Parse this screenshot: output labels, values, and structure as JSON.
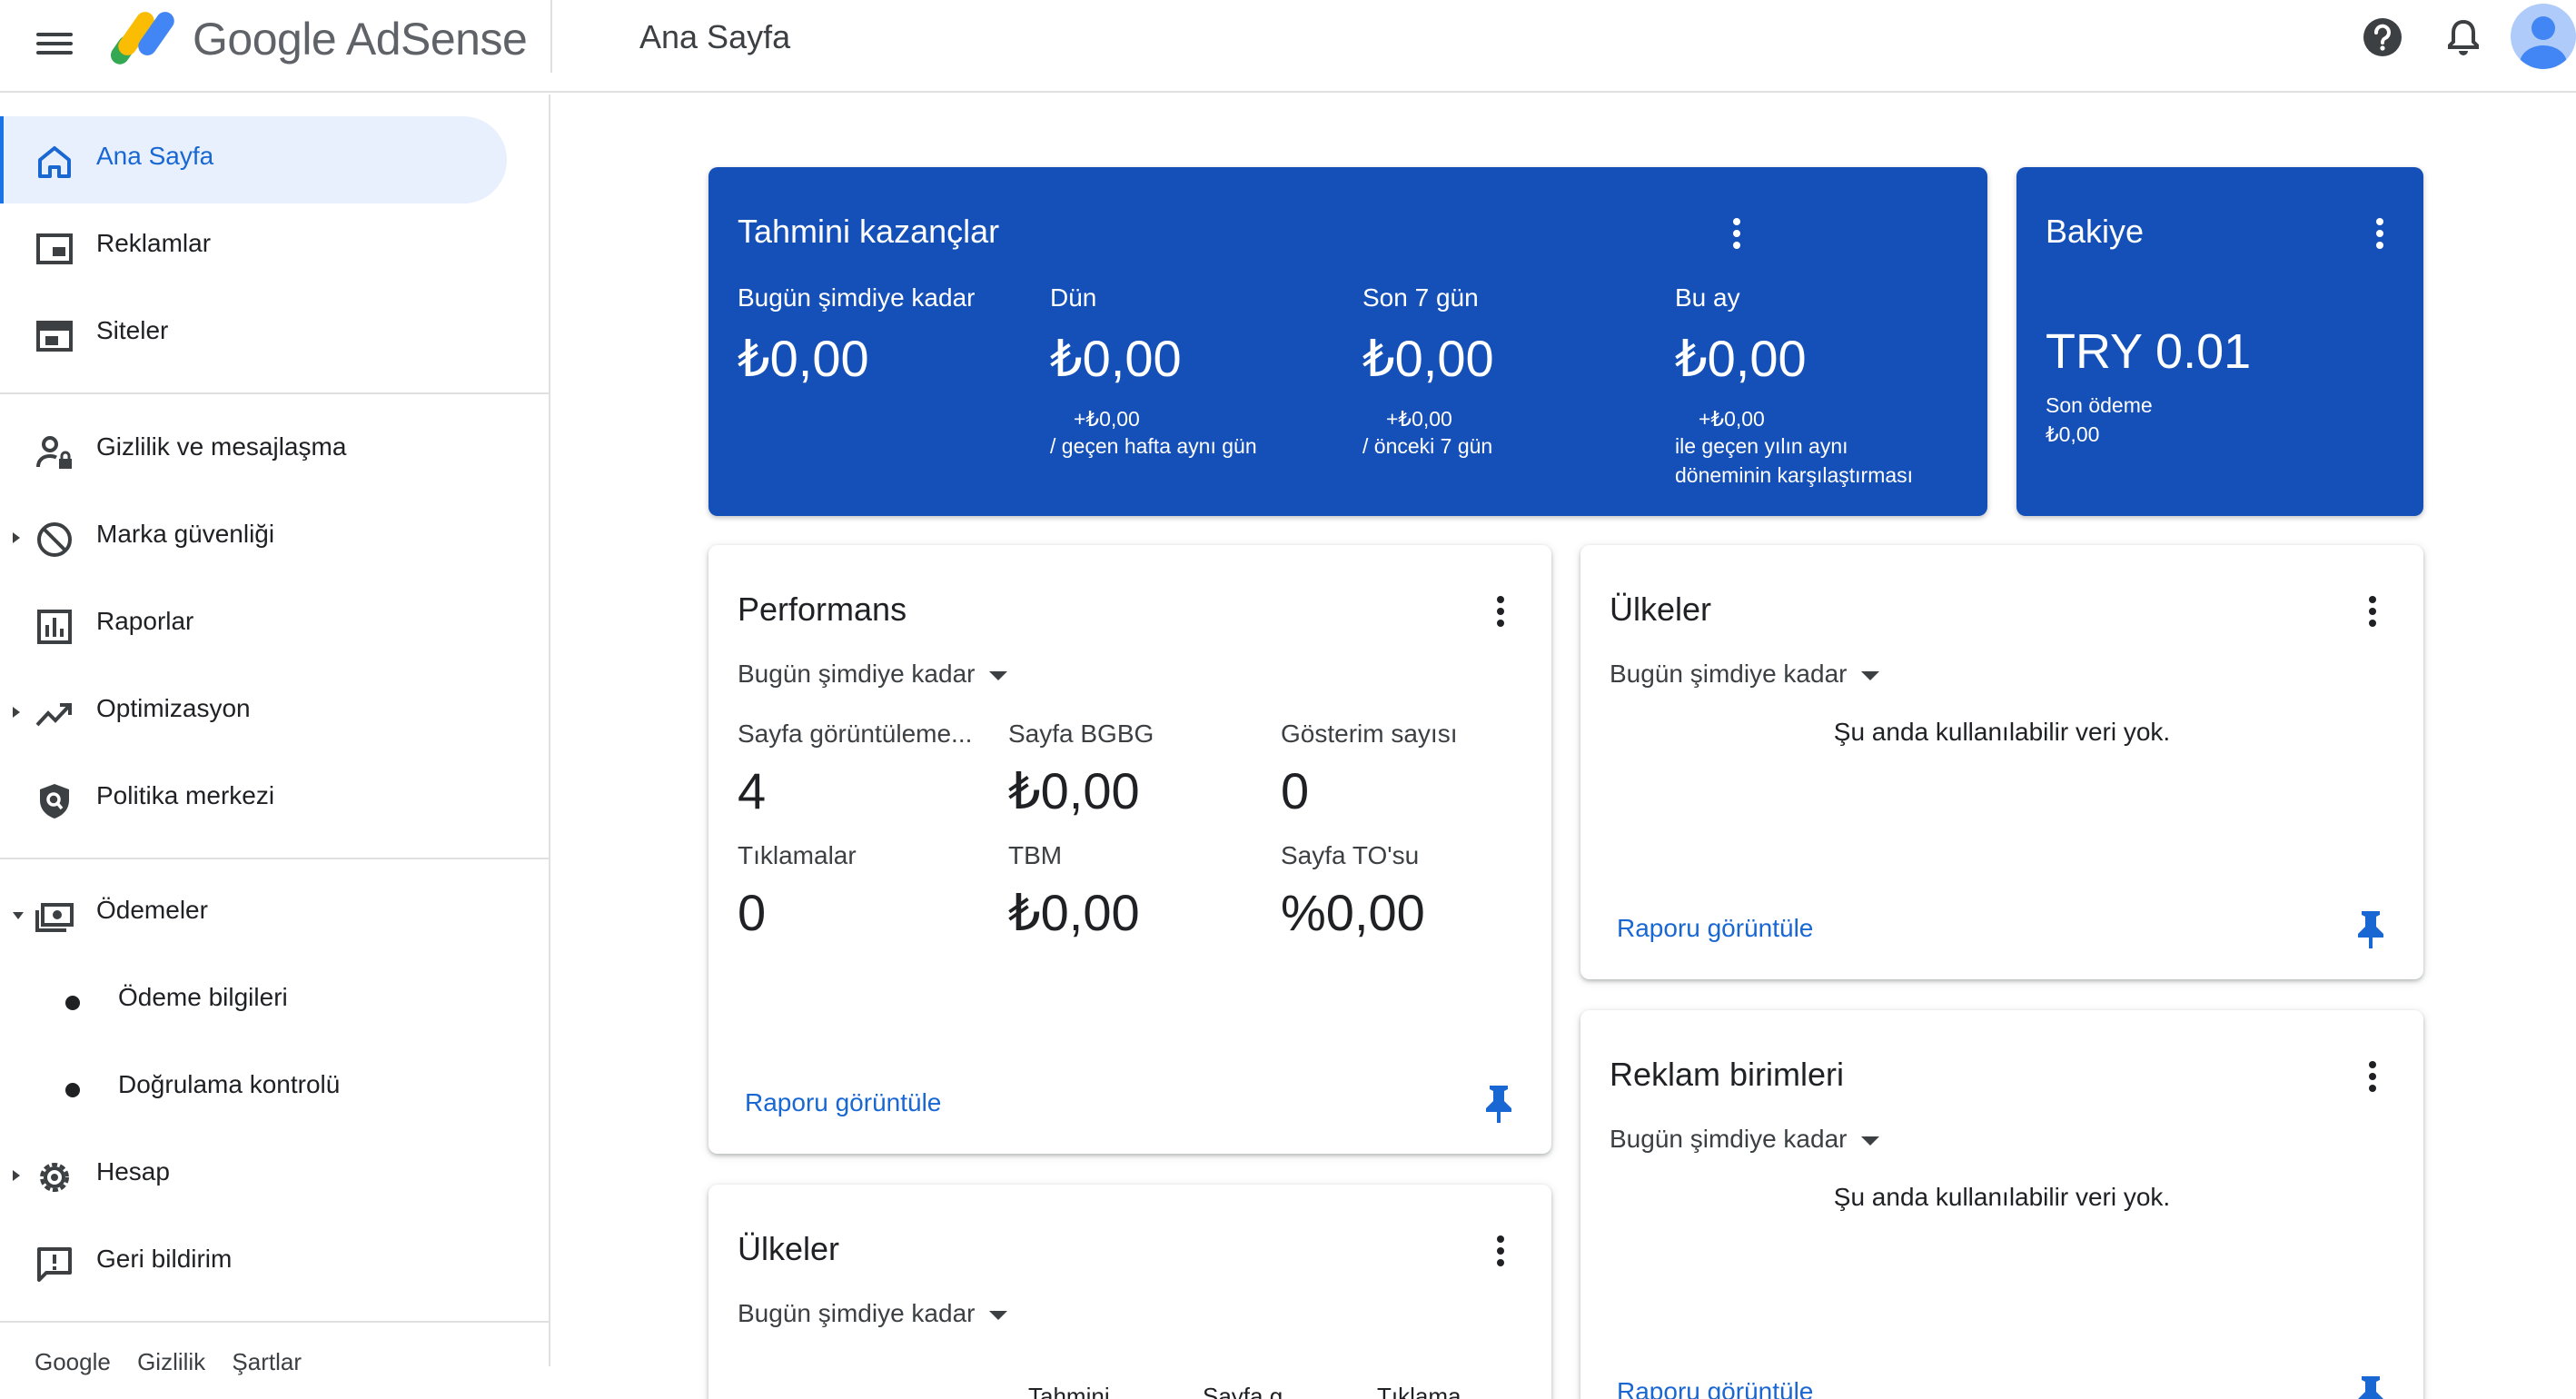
{
  "header": {
    "brand": "Google AdSense",
    "page_title": "Ana Sayfa"
  },
  "icons": {
    "menu": "menu-icon",
    "help": "help-icon",
    "notifications": "bell-icon",
    "account": "avatar"
  },
  "colors": {
    "primary_blue": "#1550b8",
    "accent": "#1967d2",
    "active_nav_bg": "#e8f0fe"
  },
  "sidebar": {
    "items": [
      {
        "label": "Ana Sayfa"
      },
      {
        "label": "Reklamlar"
      },
      {
        "label": "Siteler"
      },
      {
        "label": "Gizlilik ve mesajlaşma"
      },
      {
        "label": "Marka güvenliği"
      },
      {
        "label": "Raporlar"
      },
      {
        "label": "Optimizasyon"
      },
      {
        "label": "Politika merkezi"
      },
      {
        "label": "Ödemeler"
      },
      {
        "label": "Ödeme bilgileri"
      },
      {
        "label": "Doğrulama kontrolü"
      },
      {
        "label": "Hesap"
      },
      {
        "label": "Geri bildirim"
      }
    ],
    "footer": [
      "Google",
      "Gizlilik",
      "Şartlar"
    ]
  },
  "earnings": {
    "title": "Tahmini kazançlar",
    "columns": [
      {
        "label": "Bugün şimdiye kadar",
        "value": "₺0,00",
        "delta": "",
        "note1": "",
        "note2": ""
      },
      {
        "label": "Dün",
        "value": "₺0,00",
        "delta": "+₺0,00",
        "note1": "/ geçen hafta aynı gün",
        "note2": ""
      },
      {
        "label": "Son 7 gün",
        "value": "₺0,00",
        "delta": "+₺0,00",
        "note1": "/ önceki 7 gün",
        "note2": ""
      },
      {
        "label": "Bu ay",
        "value": "₺0,00",
        "delta": "+₺0,00",
        "note1": "ile geçen yılın aynı",
        "note2": "döneminin karşılaştırması"
      }
    ]
  },
  "balance": {
    "title": "Bakiye",
    "value": "TRY 0.01",
    "last_payment_label": "Son ödeme",
    "last_payment_value": "₺0,00"
  },
  "performance": {
    "title": "Performans",
    "range": "Bugün şimdiye kadar",
    "metrics": [
      {
        "label": "Sayfa görüntüleme...",
        "value": "4"
      },
      {
        "label": "Sayfa BGBG",
        "value": "₺0,00"
      },
      {
        "label": "Gösterim sayısı",
        "value": "0"
      },
      {
        "label": "Tıklamalar",
        "value": "0"
      },
      {
        "label": "TBM",
        "value": "₺0,00"
      },
      {
        "label": "Sayfa TO'su",
        "value": "%0,00"
      }
    ],
    "report_link": "Raporu görüntüle"
  },
  "countries_right": {
    "title": "Ülkeler",
    "range": "Bugün şimdiye kadar",
    "empty": "Şu anda kullanılabilir veri yok.",
    "report_link": "Raporu görüntüle"
  },
  "ad_units": {
    "title": "Reklam birimleri",
    "range": "Bugün şimdiye kadar",
    "empty": "Şu anda kullanılabilir veri yok.",
    "report_link": "Raporu görüntüle"
  },
  "countries_left": {
    "title": "Ülkeler",
    "range": "Bugün şimdiye kadar",
    "columns": [
      "Tahmini",
      "Sayfa g",
      "Tıklama"
    ]
  }
}
